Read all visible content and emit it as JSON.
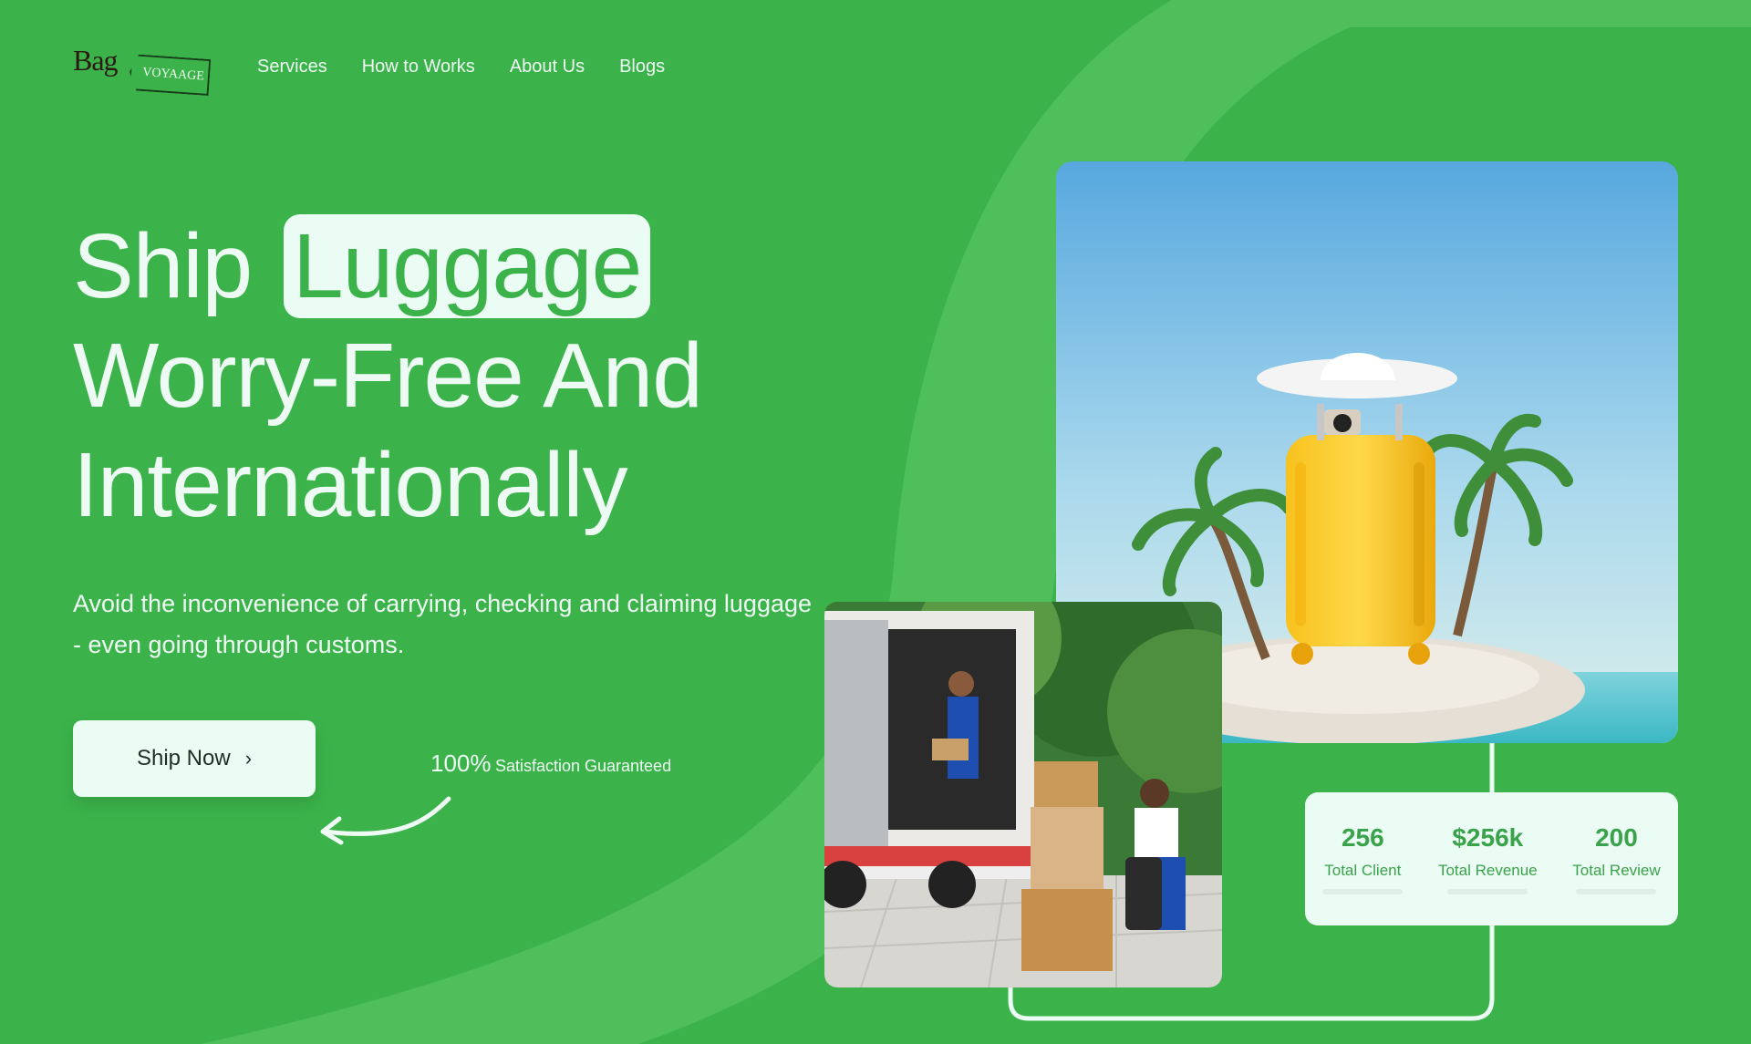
{
  "logo": {
    "word": "Bag",
    "tag": "VOYAAGE"
  },
  "nav": {
    "items": [
      "Services",
      "How to Works",
      "About Us",
      "Blogs"
    ]
  },
  "hero": {
    "title_word_1": "Ship",
    "title_highlight": "Luggage",
    "title_line_2": "Worry-Free And",
    "title_line_3": "Internationally",
    "subtitle": "Avoid the inconvenience of carrying, checking and claiming luggage - even going through customs.",
    "cta_label": "Ship Now",
    "guarantee_pct": "100%",
    "guarantee_text": "Satisfaction Guaranteed"
  },
  "stats": [
    {
      "value": "256",
      "label": "Total Client"
    },
    {
      "value": "$256k",
      "label": "Total Revenue"
    },
    {
      "value": "200",
      "label": "Total Review"
    }
  ],
  "colors": {
    "brand_green": "#3bb34a",
    "light_mint": "#eafcf3",
    "stat_green": "#3aa24a"
  },
  "icons": [
    "chevron-right-icon",
    "curved-arrow-icon",
    "luggage-tag-icon"
  ]
}
